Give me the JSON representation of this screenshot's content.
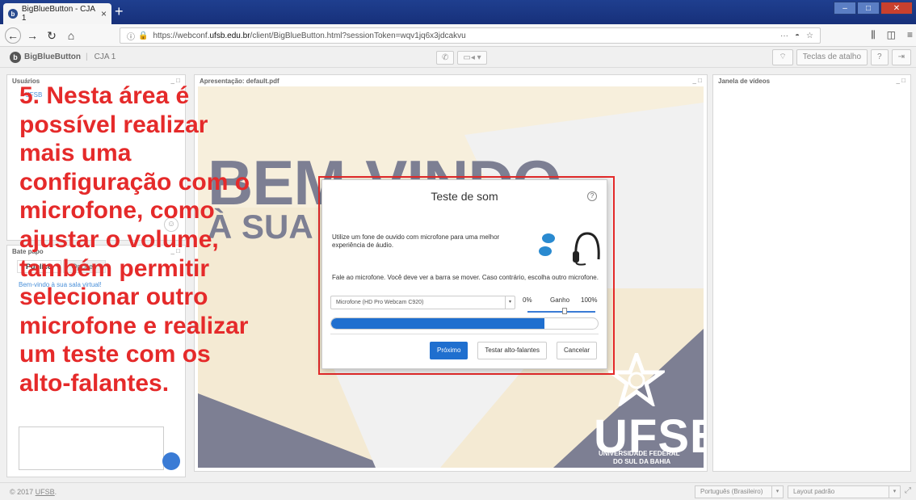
{
  "browser": {
    "tab_title": "BigBlueButton - CJA 1",
    "tab_close": "×",
    "new_tab": "+",
    "url_prefix": "https://webconf.",
    "url_domain": "ufsb.edu.br",
    "url_suffix": "/client/BigBlueButton.html?sessionToken=wqv1jq6x3jdcakvu",
    "url_right_icons": [
      "···",
      "pocket-icon",
      "star-icon"
    ]
  },
  "header": {
    "app_name": "BigBlueButton",
    "room_name": "CJA 1",
    "shortcuts_label": "Teclas de atalho"
  },
  "panels": {
    "users_title": "Usuários",
    "users_first": "UFSB",
    "chat_title": "Bate papo",
    "chat_tab_public": "Público",
    "chat_tab_options": "Opções",
    "chat_welcome": "Bem-vindo à sua sala virtual!",
    "presentation_title": "Apresentação: default.pdf",
    "video_title": "Janela de vídeos",
    "panel_controls": "_ □"
  },
  "slide": {
    "headline": "BEM-VINDO",
    "subheadline": "À SUA",
    "logo_text": "UFSB",
    "logo_sub1": "UNIVERSIDADE FEDERAL",
    "logo_sub2": "DO SUL DA BAHIA"
  },
  "modal": {
    "title": "Teste de som",
    "description": "Utilize um fone de ouvido com microfone para uma melhor experiência de áudio.",
    "instruction": "Fale ao microfone. Você deve ver a barra se mover. Caso contrário, escolha outro microfone.",
    "microphone": "Microfone (HD Pro Webcam C920)",
    "gain_min": "0%",
    "gain_label": "Ganho",
    "gain_max": "100%",
    "gain_level": 0.55,
    "mic_level": 0.8,
    "next_button": "Próximo",
    "test_speakers_button": "Testar alto-falantes",
    "cancel_button": "Cancelar"
  },
  "footer": {
    "copyright_prefix": "© 2017 ",
    "copyright_link": "UFSB",
    "copyright_suffix": ".",
    "language": "Português (Brasileiro)",
    "layout": "Layout padrão"
  },
  "annotation": {
    "text": "5. Nesta área é\npossível realizar\nmais uma\nconfiguração com o\nmicrofone, como\najustar o volume,\ntambém permitir\nselecionar outro\nmicrofone e realizar\num teste com os\nalto-falantes."
  },
  "colors": {
    "annotation_red": "#e52a2a",
    "primary_blue": "#1f6fcf",
    "slide_gray": "#7d7f93",
    "slide_cream": "#f4ead3"
  }
}
